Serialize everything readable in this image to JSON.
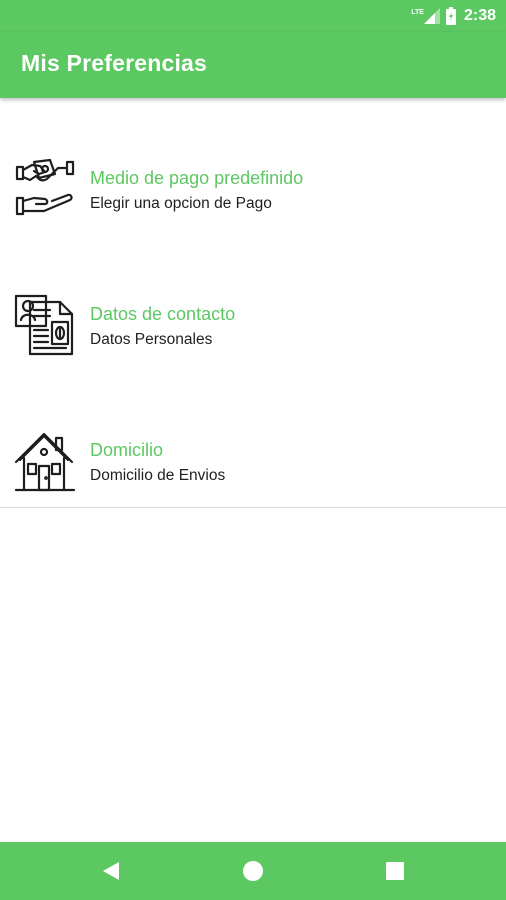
{
  "status_bar": {
    "network_label": "LTE",
    "time": "2:38"
  },
  "app_bar": {
    "title": "Mis Preferencias"
  },
  "menu": [
    {
      "title": "Medio de pago predefinido",
      "subtitle": "Elegir una opcion de Pago",
      "icon": "handshake-payment-icon"
    },
    {
      "title": "Datos de contacto",
      "subtitle": "Datos Personales",
      "icon": "contact-card-icon"
    },
    {
      "title": "Domicilio",
      "subtitle": "Domicilio de Envios",
      "icon": "house-icon"
    }
  ],
  "colors": {
    "accent": "#5CC862",
    "text_primary": "#212121"
  },
  "nav_bar": {
    "buttons": [
      "back-icon",
      "home-icon",
      "recents-icon"
    ]
  }
}
